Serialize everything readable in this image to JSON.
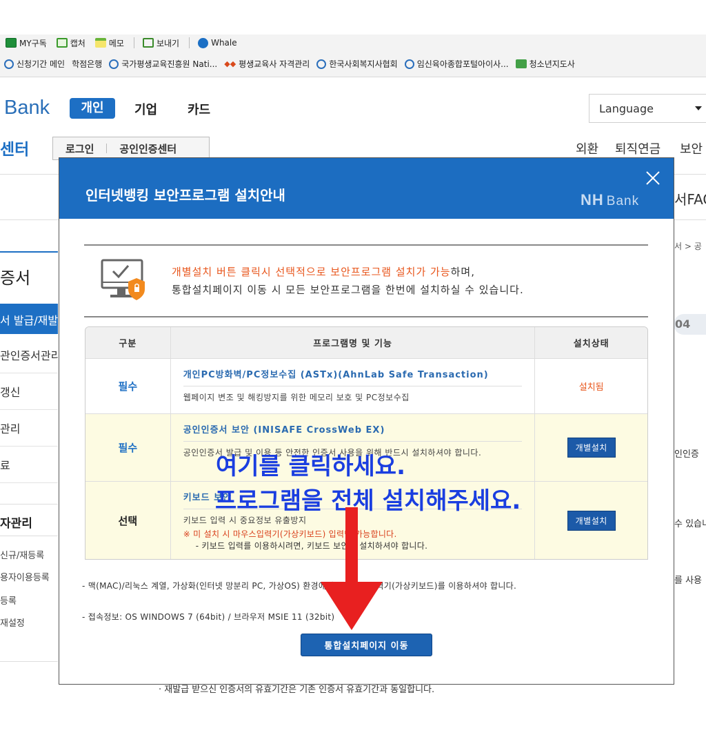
{
  "browser": {
    "toolbar": [
      {
        "icon": "news-icon",
        "label": "MY구독",
        "color": "#1f8f3a"
      },
      {
        "icon": "capture-icon",
        "label": "캡처",
        "color": "#3a9a2a"
      },
      {
        "icon": "memo-icon",
        "label": "메모",
        "color": "#6bb53a"
      },
      {
        "icon": "share-icon",
        "label": "보내기",
        "color": "#3a8a2a"
      },
      {
        "icon": "whale-icon",
        "label": "Whale",
        "color": "#1b6fc4"
      }
    ],
    "favorites": [
      {
        "icon": "",
        "label": "신청기간 메인"
      },
      {
        "icon": "none",
        "label": "학점은행"
      },
      {
        "icon": "ie",
        "label": "국가평생교육진흥원 Nati..."
      },
      {
        "icon": "diamond",
        "label": "평생교육사 자격관리"
      },
      {
        "icon": "ie",
        "label": "한국사회복지사협회"
      },
      {
        "icon": "ie",
        "label": "임신육아종합포털아이사..."
      },
      {
        "icon": "blog",
        "label": "청소년지도사"
      }
    ]
  },
  "header": {
    "logo": "Bank",
    "gnb": [
      "개인",
      "기업",
      "카드"
    ],
    "language": "Language",
    "subtitle": "센터",
    "login": "로그인",
    "cert_center": "공인인증센터",
    "util": [
      "외환",
      "퇴직연금",
      "보안"
    ]
  },
  "sidebar": {
    "title": "증서",
    "active": "서 발급/재발",
    "items": [
      "관인증서관리",
      "갱신",
      "관리",
      "료"
    ],
    "group": "자관리",
    "subs": [
      "신규/재등록",
      "용자이용등록",
      "등록",
      "재설정"
    ]
  },
  "background": {
    "faq": "서FAQ",
    "breadcrumb": "서 > 공",
    "step": "04",
    "r1": "인인증",
    "r2": "수 있습니",
    "r3": "를 사용",
    "bottom_note": "· 재발급 받으신 인증서의 유효기간은 기존 인증서 유효기간과 동일합니다."
  },
  "modal": {
    "title": "인터넷뱅킹 보안프로그램 설치안내",
    "brand": "NH",
    "brand_sub": "Bank",
    "notice_highlight": "개별설치 버튼 클릭시 선택적으로 보안프로그램 설치가 가능",
    "notice_rest": "하며,",
    "notice_line2": "통합설치페이지 이동 시 모든 보안프로그램을 한번에 설치하실 수 있습니다.",
    "table": {
      "headers": [
        "구분",
        "프로그램명 및 기능",
        "설치상태"
      ],
      "rows": [
        {
          "category": "필수",
          "name": "개인PC방화벽/PC정보수집 (ASTx)(AhnLab Safe Transaction)",
          "desc": "웹페이지 변조 및 해킹방지를 위한 메모리 보호 및 PC정보수집",
          "status": "설치됨"
        },
        {
          "category": "필수",
          "name": "공인인증서 보안 (INISAFE CrossWeb EX)",
          "desc": "공인인증서 발급 및 이용 등 안전한 인증서 사용을 위해 반드시 설치하셔야 합니다.",
          "button": "개별설치"
        },
        {
          "category": "선택",
          "name": "키보드 보안",
          "desc": "키보드 입력 시 중요정보 유출방지",
          "warn": "※ 미 설치 시 마우스입력기(가상키보드) 입력만 가능합니다.",
          "warn2": "- 키보드 입력를 이용하시려면, 키보드 보안을 설치하셔야 합니다.",
          "button": "개별설치"
        }
      ]
    },
    "footnote1": "- 맥(MAC)/리눅스 계열, 가상화(인터넷 망분리 PC, 가상OS) 환경에서는 마우스입력기(가상키보드)를 이용하셔야 합니다.",
    "footnote2": "- 접속정보: OS WINDOWS 7 (64bit) / 브라우저 MSIE 11 (32bit)",
    "install_all": "통합설치페이지 이동"
  },
  "annotation": {
    "line1": "여기를 클릭하세요.",
    "line2": "프로그램을 전체 설치해주세요.",
    "color": "#1a3ee0",
    "arrow_color": "#e82020"
  }
}
